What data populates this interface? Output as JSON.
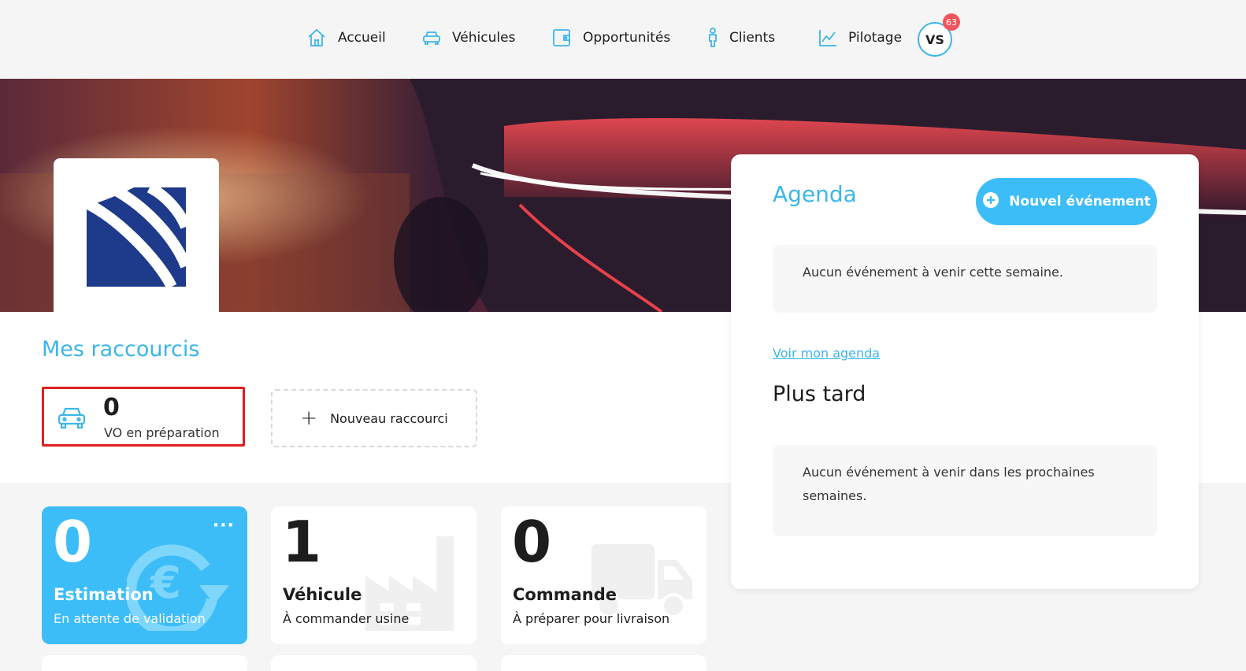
{
  "nav": {
    "items": [
      {
        "label": "Accueil",
        "icon": "home-icon"
      },
      {
        "label": "Véhicules",
        "icon": "car-icon"
      },
      {
        "label": "Opportunités",
        "icon": "wallet-icon"
      },
      {
        "label": "Clients",
        "icon": "person-icon"
      },
      {
        "label": "Pilotage",
        "icon": "chart-icon"
      }
    ],
    "avatar_initials": "VS",
    "notification_count": "63"
  },
  "shortcuts": {
    "title": "Mes raccourcis",
    "items": [
      {
        "count": "0",
        "label": "VO en préparation",
        "icon": "car-icon"
      }
    ],
    "new_label": "Nouveau raccourci"
  },
  "tiles": [
    {
      "count": "0",
      "title": "Estimation",
      "subtitle": "En attente de validation",
      "icon": "euro-refresh-icon",
      "more": "···"
    },
    {
      "count": "1",
      "title": "Véhicule",
      "subtitle": "À commander usine",
      "icon": "factory-icon"
    },
    {
      "count": "0",
      "title": "Commande",
      "subtitle": "À préparer pour livraison",
      "icon": "truck-icon"
    }
  ],
  "agenda": {
    "title": "Agenda",
    "new_event_label": "Nouvel événement",
    "this_week_empty": "Aucun événement à venir cette semaine.",
    "link_label": "Voir mon agenda",
    "later_title": "Plus tard",
    "later_empty": "Aucun événement à venir dans les prochaines semaines."
  },
  "colors": {
    "accent": "#3bb6e8",
    "tile_blue": "#3dbdf8",
    "badge_red": "#f2545b",
    "highlight_red": "#e01e1e",
    "logo_navy": "#1e3a8a"
  }
}
